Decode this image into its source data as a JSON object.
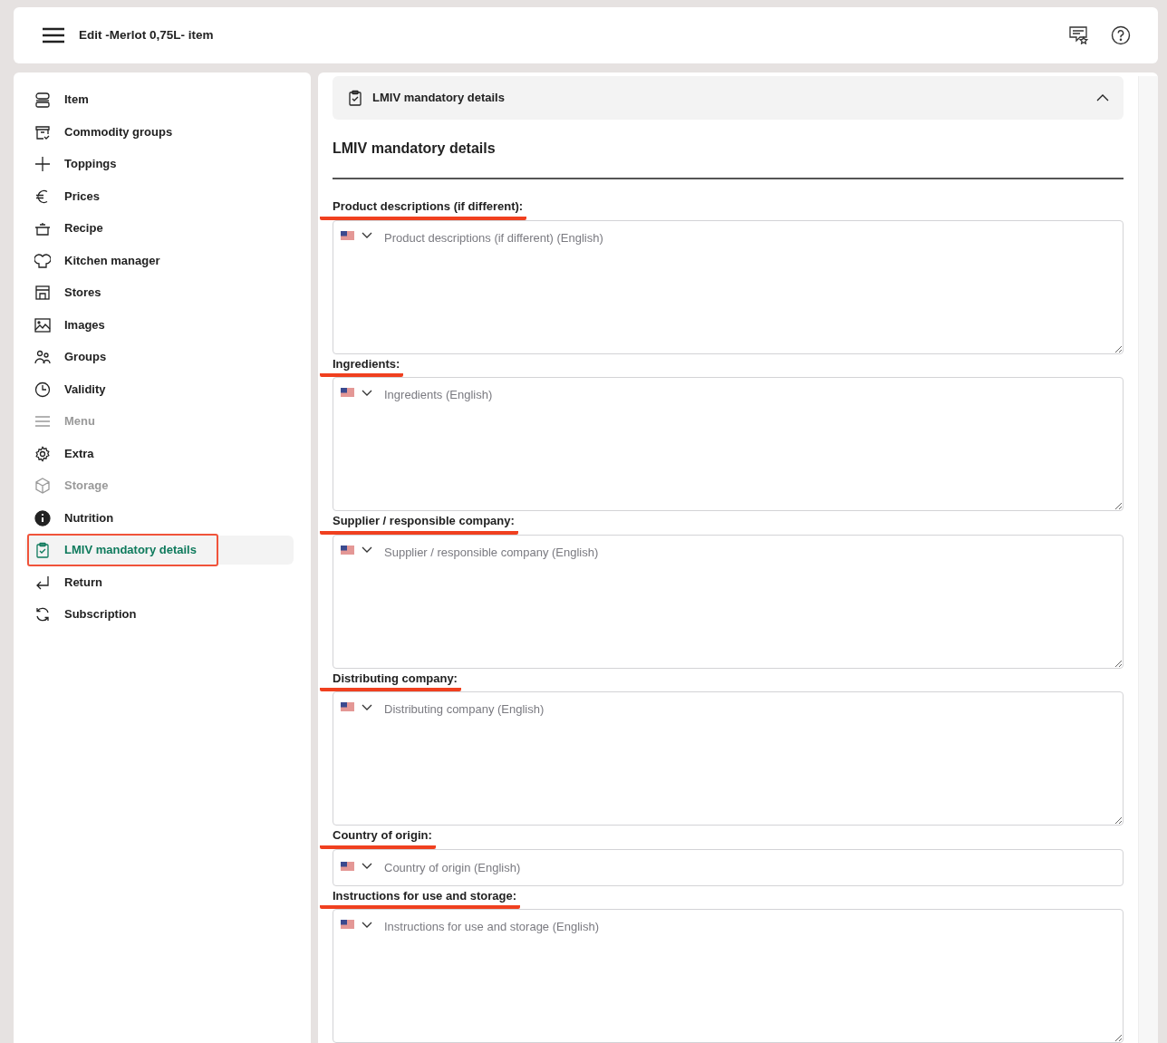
{
  "header": {
    "title": "Edit -Merlot 0,75L- item"
  },
  "sidebar": {
    "items": [
      {
        "label": "Item",
        "selected": false,
        "disabled": false,
        "annotated": false
      },
      {
        "label": "Commodity groups",
        "selected": false,
        "disabled": false,
        "annotated": false
      },
      {
        "label": "Toppings",
        "selected": false,
        "disabled": false,
        "annotated": false
      },
      {
        "label": "Prices",
        "selected": false,
        "disabled": false,
        "annotated": false
      },
      {
        "label": "Recipe",
        "selected": false,
        "disabled": false,
        "annotated": false
      },
      {
        "label": "Kitchen manager",
        "selected": false,
        "disabled": false,
        "annotated": false
      },
      {
        "label": "Stores",
        "selected": false,
        "disabled": false,
        "annotated": false
      },
      {
        "label": "Images",
        "selected": false,
        "disabled": false,
        "annotated": false
      },
      {
        "label": "Groups",
        "selected": false,
        "disabled": false,
        "annotated": false
      },
      {
        "label": "Validity",
        "selected": false,
        "disabled": false,
        "annotated": false
      },
      {
        "label": "Menu",
        "selected": false,
        "disabled": true,
        "annotated": false
      },
      {
        "label": "Extra",
        "selected": false,
        "disabled": false,
        "annotated": false
      },
      {
        "label": "Storage",
        "selected": false,
        "disabled": true,
        "annotated": false
      },
      {
        "label": "Nutrition",
        "selected": false,
        "disabled": false,
        "annotated": false
      },
      {
        "label": "LMIV mandatory details",
        "selected": true,
        "disabled": false,
        "annotated": true
      },
      {
        "label": "Return",
        "selected": false,
        "disabled": false,
        "annotated": false
      },
      {
        "label": "Subscription",
        "selected": false,
        "disabled": false,
        "annotated": false
      }
    ]
  },
  "accordion": {
    "title": "LMIV mandatory details",
    "expanded": true
  },
  "section": {
    "title": "LMIV mandatory details"
  },
  "fields": [
    {
      "kind": "textarea",
      "label": "Product descriptions (if different):",
      "placeholder": "Product descriptions (if different) (English)",
      "annotated": true
    },
    {
      "kind": "textarea",
      "label": "Ingredients:",
      "placeholder": "Ingredients (English)",
      "annotated": true
    },
    {
      "kind": "textarea",
      "label": "Supplier / responsible company:",
      "placeholder": "Supplier / responsible company (English)",
      "annotated": true
    },
    {
      "kind": "textarea",
      "label": "Distributing company:",
      "placeholder": "Distributing company (English)",
      "annotated": true
    },
    {
      "kind": "input",
      "label": "Country of origin:",
      "placeholder": "Country of origin (English)",
      "annotated": true
    },
    {
      "kind": "textarea",
      "label": "Instructions for use and storage:",
      "placeholder": "Instructions for use and storage (English)",
      "annotated": true
    }
  ]
}
